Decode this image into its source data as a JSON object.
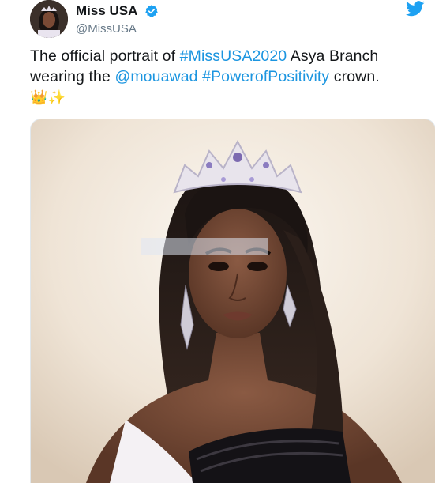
{
  "account": {
    "display_name": "Miss USA",
    "handle": "@MissUSA",
    "verified_icon": "verified-badge-icon",
    "platform_icon": "twitter-bird-icon"
  },
  "tweet": {
    "text_parts": [
      {
        "text": "The official portrait of ",
        "type": "text"
      },
      {
        "text": "#MissUSA2020",
        "type": "hashtag"
      },
      {
        "text": " Asya Branch wearing the ",
        "type": "text"
      },
      {
        "text": "@mouawad",
        "type": "mention"
      },
      {
        "text": " ",
        "type": "text"
      },
      {
        "text": "#PowerofPositivity",
        "type": "hashtag"
      },
      {
        "text": " crown.",
        "type": "text"
      }
    ],
    "emojis": [
      "👑",
      "✨"
    ]
  },
  "media": {
    "type": "photo",
    "description_icon": "portrait-photo"
  },
  "colors": {
    "link": "#1b95e0",
    "verified": "#1da1f2",
    "bird": "#1da1f2",
    "secondary_text": "#657786"
  }
}
